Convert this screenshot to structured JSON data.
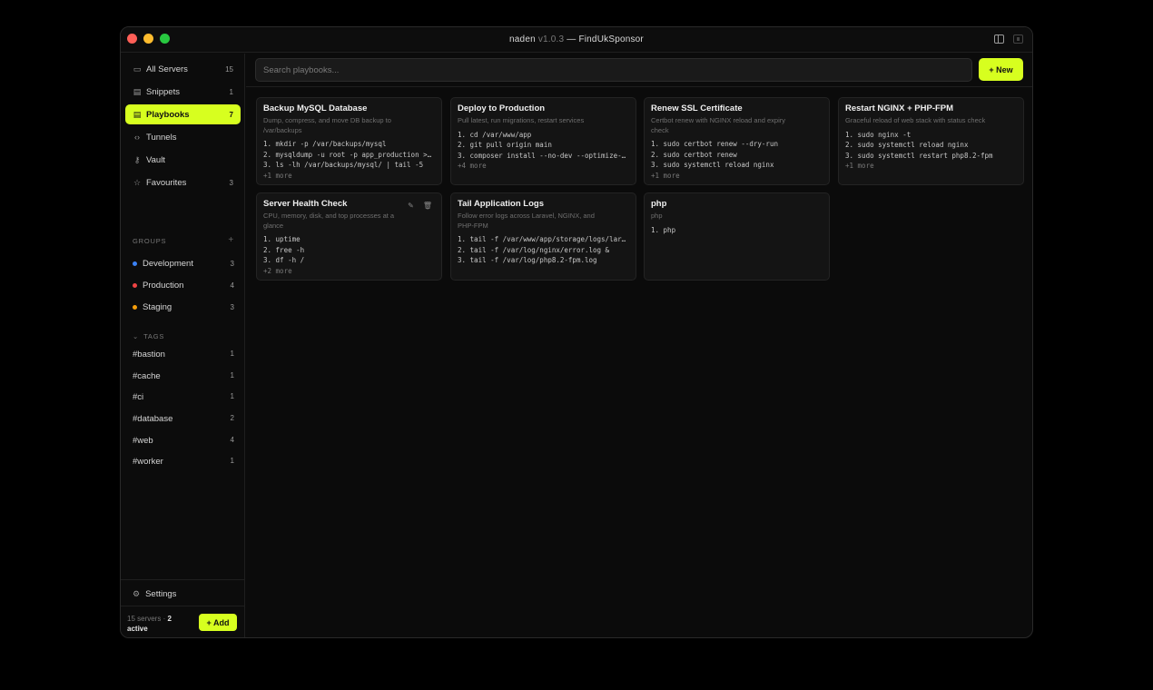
{
  "window": {
    "app_name": "naden",
    "version": "v1.0.3",
    "subtitle": "— FindUkSponsor"
  },
  "sidebar": {
    "nav": [
      {
        "label": "All Servers",
        "count": "15",
        "icon": "monitor-icon"
      },
      {
        "label": "Snippets",
        "count": "1",
        "icon": "document-icon"
      },
      {
        "label": "Playbooks",
        "count": "7",
        "icon": "playbook-icon",
        "active": true
      },
      {
        "label": "Tunnels",
        "count": "",
        "icon": "tunnel-icon"
      },
      {
        "label": "Vault",
        "count": "",
        "icon": "key-icon"
      },
      {
        "label": "Favourites",
        "count": "3",
        "icon": "star-icon"
      }
    ],
    "groups_header": "GROUPS",
    "groups": [
      {
        "label": "Development",
        "count": "3",
        "color": "#3b82f6"
      },
      {
        "label": "Production",
        "count": "4",
        "color": "#ef4444"
      },
      {
        "label": "Staging",
        "count": "3",
        "color": "#f59e0b"
      }
    ],
    "tags_header": "TAGS",
    "tags": [
      {
        "label": "#bastion",
        "count": "1"
      },
      {
        "label": "#cache",
        "count": "1"
      },
      {
        "label": "#ci",
        "count": "1"
      },
      {
        "label": "#database",
        "count": "2"
      },
      {
        "label": "#web",
        "count": "4"
      },
      {
        "label": "#worker",
        "count": "1"
      }
    ],
    "settings_label": "Settings",
    "status_prefix": "15 servers ·",
    "status_active": "2",
    "status_suffix": "active",
    "add_label": "+ Add"
  },
  "main": {
    "search_placeholder": "Search playbooks...",
    "new_label": "+ New",
    "cards": [
      {
        "title": "Backup MySQL Database",
        "desc": "Dump, compress, and move DB backup to /var/backups",
        "steps": [
          "1. mkdir -p /var/backups/mysql",
          "2. mysqldump -u root -p app_production > /var/backups/mysql/app.sql",
          "3. ls -lh /var/backups/mysql/ | tail -5"
        ],
        "more": "+1 more"
      },
      {
        "title": "Deploy to Production",
        "desc": "Pull latest, run migrations, restart services",
        "steps": [
          "1. cd /var/www/app",
          "2. git pull origin main",
          "3. composer install --no-dev --optimize-autoloader"
        ],
        "more": "+4 more"
      },
      {
        "title": "Renew SSL Certificate",
        "desc": "Certbot renew with NGINX reload and expiry check",
        "steps": [
          "1. sudo certbot renew --dry-run",
          "2. sudo certbot renew",
          "3. sudo systemctl reload nginx"
        ],
        "more": "+1 more"
      },
      {
        "title": "Restart NGINX + PHP-FPM",
        "desc": "Graceful reload of web stack with status check",
        "steps": [
          "1. sudo nginx -t",
          "2. sudo systemctl reload nginx",
          "3. sudo systemctl restart php8.2-fpm"
        ],
        "more": "+1 more"
      },
      {
        "title": "Server Health Check",
        "desc": "CPU, memory, disk, and top processes at a glance",
        "steps": [
          "1. uptime",
          "2. free -h",
          "3. df -h /"
        ],
        "more": "+2 more",
        "hovered": true
      },
      {
        "title": "Tail Application Logs",
        "desc": "Follow error logs across Laravel, NGINX, and PHP-FPM",
        "steps": [
          "1. tail -f /var/www/app/storage/logs/laravel.log",
          "2. tail -f /var/log/nginx/error.log &",
          "3. tail -f /var/log/php8.2-fpm.log"
        ],
        "more": ""
      },
      {
        "title": "php",
        "desc": "php",
        "steps": [
          "1. php"
        ],
        "more": ""
      }
    ]
  },
  "colors": {
    "accent": "#d7ff1f",
    "background": "#0b0b0b",
    "card": "#141414"
  }
}
